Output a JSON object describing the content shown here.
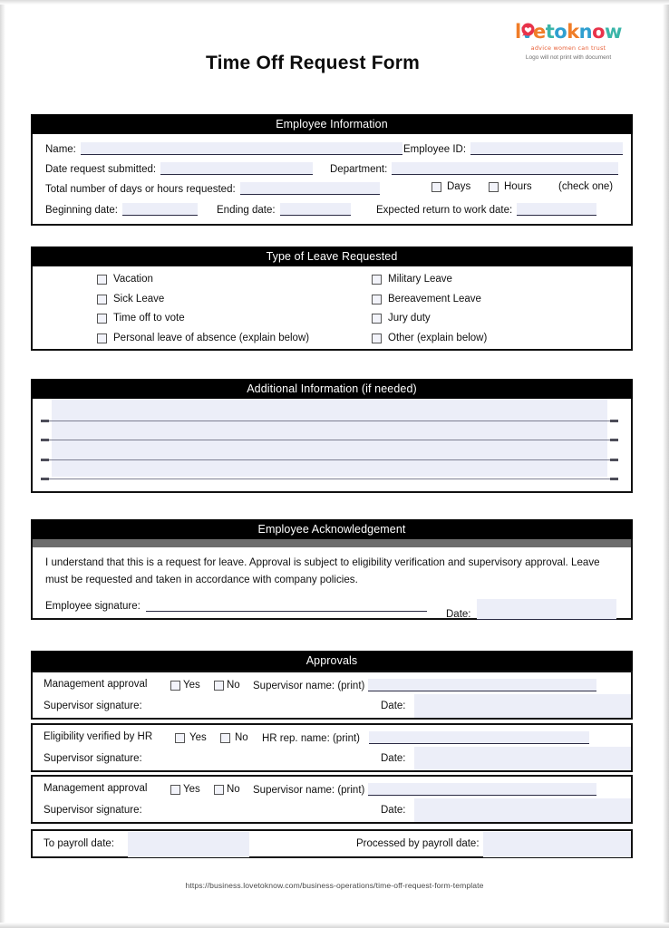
{
  "document": {
    "title": "Time Off Request Form",
    "footer_url": "https://business.lovetoknow.com/business-operations/time-off-request-form-template"
  },
  "logo": {
    "letters": [
      {
        "ch": "l",
        "color": "#f07d28"
      },
      {
        "ch": "o",
        "color": "#e8334a"
      },
      {
        "ch": "v",
        "color": "#2f9fd0"
      },
      {
        "ch": "e",
        "color": "#f07d28"
      },
      {
        "ch": "t",
        "color": "#3ab5a8"
      },
      {
        "ch": "o",
        "color": "#2f9fd0"
      },
      {
        "ch": "k",
        "color": "#f07d28"
      },
      {
        "ch": "n",
        "color": "#2f9fd0"
      },
      {
        "ch": "o",
        "color": "#e8334a"
      },
      {
        "ch": "w",
        "color": "#3ab5a8"
      }
    ],
    "tagline": "advice women can trust",
    "print_note": "Logo will not print with document",
    "heart_color": "#e8334a"
  },
  "sections": {
    "employee_information": {
      "heading": "Employee Information",
      "name_label": "Name:",
      "employee_id_label": "Employee ID:",
      "date_submitted_label": "Date request submitted:",
      "department_label": "Department:",
      "total_days_label": "Total number of days or hours requested:",
      "days_checkbox_label": "Days",
      "hours_checkbox_label": "Hours",
      "check_one_note": "(check one)",
      "beginning_date_label": "Beginning date:",
      "ending_date_label": "Ending date:",
      "expected_return_label": "Expected return to work date:",
      "values": {
        "name": "",
        "employee_id": "",
        "date_submitted": "",
        "department": "",
        "total_days_hours": "",
        "beginning_date": "",
        "ending_date": "",
        "expected_return": ""
      }
    },
    "type_of_leave": {
      "heading": "Type of Leave Requested",
      "left_options": [
        "Vacation",
        "Sick Leave",
        "Time off to vote",
        "Personal leave of absence (explain below)"
      ],
      "right_options": [
        "Military Leave",
        "Bereavement Leave",
        "Jury duty",
        "Other (explain below)"
      ]
    },
    "additional_information": {
      "heading": "Additional Information (if needed)",
      "lines": [
        "",
        "",
        "",
        ""
      ]
    },
    "employee_acknowledgement": {
      "heading": "Employee Acknowledgement",
      "body_text": "I understand that this is a request for leave. Approval is subject to eligibility verification and supervisory approval. Leave must be requested and taken in accordance with company policies.",
      "signature_label": "Employee signature:",
      "date_label": "Date:",
      "values": {
        "signature": "",
        "date": ""
      }
    },
    "approvals": {
      "heading": "Approvals",
      "blocks": [
        {
          "approval_label": "Management approval",
          "yes_label": "Yes",
          "no_label": "No",
          "name_label": "Supervisor name: (print)",
          "signature_label": "Supervisor signature:",
          "date_label": "Date:",
          "values": {
            "name": "",
            "signature": "",
            "date": ""
          }
        },
        {
          "approval_label": "Eligibility verified by HR",
          "yes_label": "Yes",
          "no_label": "No",
          "name_label": "HR rep. name: (print)",
          "signature_label": "Supervisor signature:",
          "date_label": "Date:",
          "values": {
            "name": "",
            "signature": "",
            "date": ""
          }
        },
        {
          "approval_label": "Management approval",
          "yes_label": "Yes",
          "no_label": "No",
          "name_label": "Supervisor name: (print)",
          "signature_label": "Supervisor signature:",
          "date_label": "Date:",
          "values": {
            "name": "",
            "signature": "",
            "date": ""
          }
        }
      ],
      "payroll": {
        "to_payroll_label": "To payroll date:",
        "processed_label": "Processed by payroll date:",
        "values": {
          "to_payroll_date": "",
          "processed_date": ""
        }
      }
    }
  },
  "colors": {
    "header_bar": "#000000",
    "field_fill": "#eceef8",
    "field_underline": "#2b2b44",
    "border": "#111111"
  }
}
